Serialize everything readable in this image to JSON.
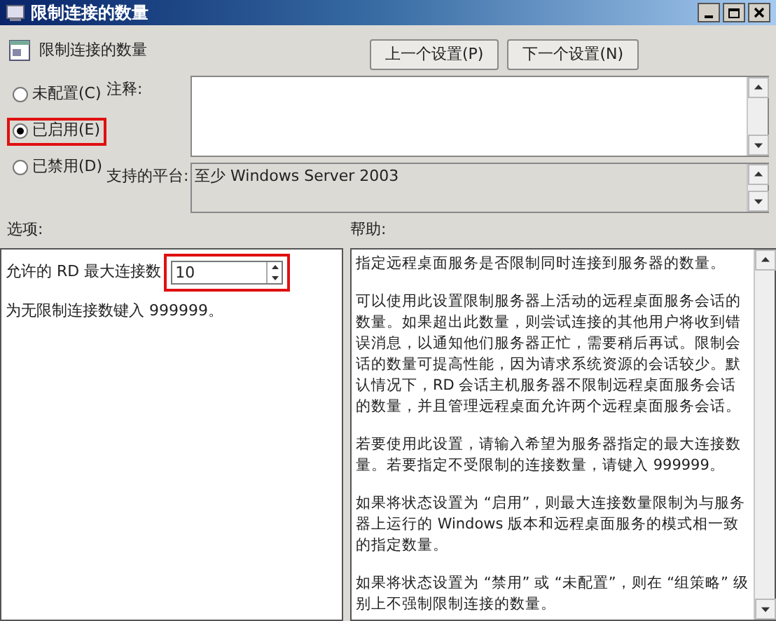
{
  "window": {
    "title": "限制连接的数量"
  },
  "setting_name": "限制连接的数量",
  "nav_buttons": [
    "上一个设置(P)",
    "下一个设置(N)"
  ],
  "state_options": [
    {
      "label": "未配置(C)",
      "selected": false,
      "highlighted": false
    },
    {
      "label": "已启用(E)",
      "selected": true,
      "highlighted": true
    },
    {
      "label": "已禁用(D)",
      "selected": false,
      "highlighted": false
    }
  ],
  "comment": {
    "label": "注释:"
  },
  "platform": {
    "label": "支持的平台:",
    "value": "至少 Windows Server 2003"
  },
  "options": {
    "label": "选项:",
    "field_label": "允许的 RD 最大连接数",
    "field_value": "10",
    "field_highlighted": true,
    "hint": "为无限制连接数键入 999999。"
  },
  "help": {
    "label": "帮助:",
    "paragraphs": [
      "指定远程桌面服务是否限制同时连接到服务器的数量。",
      "可以使用此设置限制服务器上活动的远程桌面服务会话的数量。如果超出此数量，则尝试连接的其他用户将收到错误消息，以通知他们服务器正忙，需要稍后再试。限制会话的数量可提高性能，因为请求系统资源的会话较少。默认情况下，RD 会话主机服务器不限制远程桌面服务会话的数量，并且管理远程桌面允许两个远程桌面服务会话。",
      "若要使用此设置，请输入希望为服务器指定的最大连接数量。若要指定不受限制的连接数量，请键入 999999。",
      "如果将状态设置为 “启用”，则最大连接数量限制为与服务器上运行的 Windows 版本和远程桌面服务的模式相一致的指定数量。",
      "如果将状态设置为 “禁用” 或 “未配置”，则在 “组策略” 级别上不强制限制连接的数量。"
    ]
  }
}
